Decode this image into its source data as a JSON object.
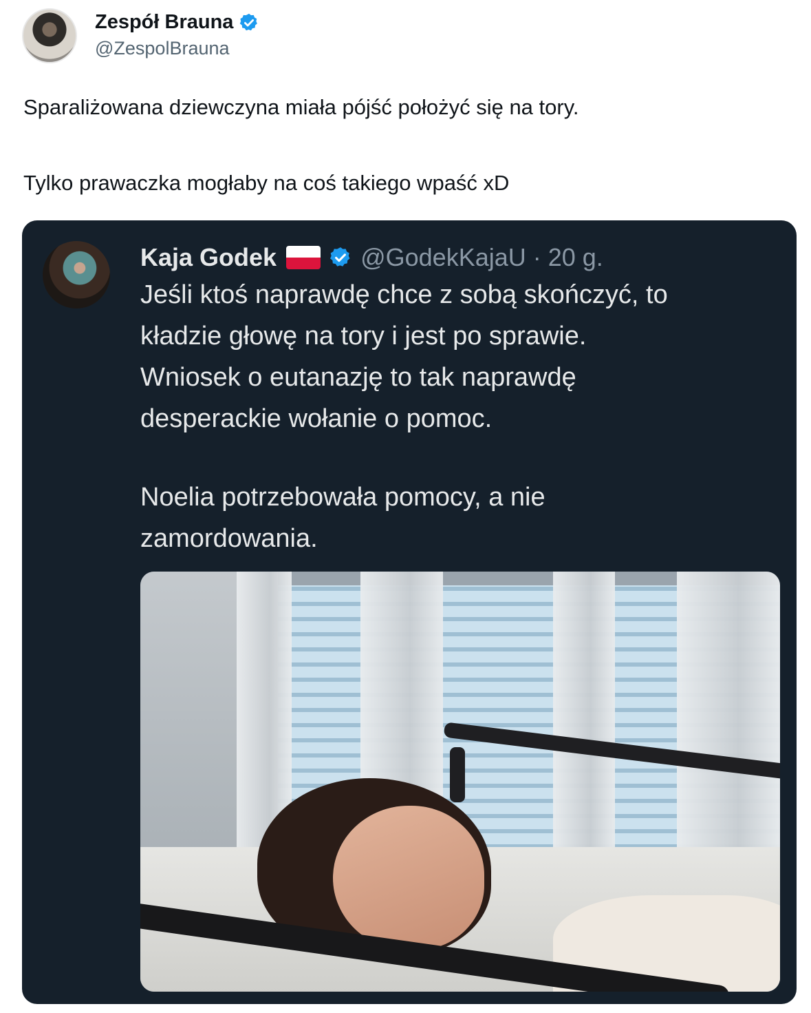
{
  "outer_tweet": {
    "author_name": "Zespół Brauna",
    "handle": "@ZespolBrauna",
    "text_line1": "Sparaliżowana dziewczyna miała pójść położyć się na tory.",
    "text_line2": "Tylko prawaczka mogłaby na coś takiego wpaść xD",
    "verified": true
  },
  "quoted_tweet": {
    "author_name": "Kaja Godek",
    "flag": "Poland",
    "handle_time": "@GodekKajaU · 20 g.",
    "verified": true,
    "text_line1": "Jeśli ktoś naprawdę chce z sobą skończyć, to",
    "text_line2": "kładzie głowę na tory i jest po sprawie.",
    "text_line3": "Wniosek o eutanazję to tak naprawdę",
    "text_line4": "desperackie wołanie o pomoc.",
    "text_line5": "Noelia potrzebowała pomocy, a nie",
    "text_line6": "zamordowania.",
    "more_icon": "more-vertical-icon",
    "media": "photo"
  },
  "colors": {
    "quote_bg": "#15202b",
    "verified_blue": "#1d9bf0",
    "text_light": "#e7e9ea",
    "text_muted": "#8b98a5"
  }
}
